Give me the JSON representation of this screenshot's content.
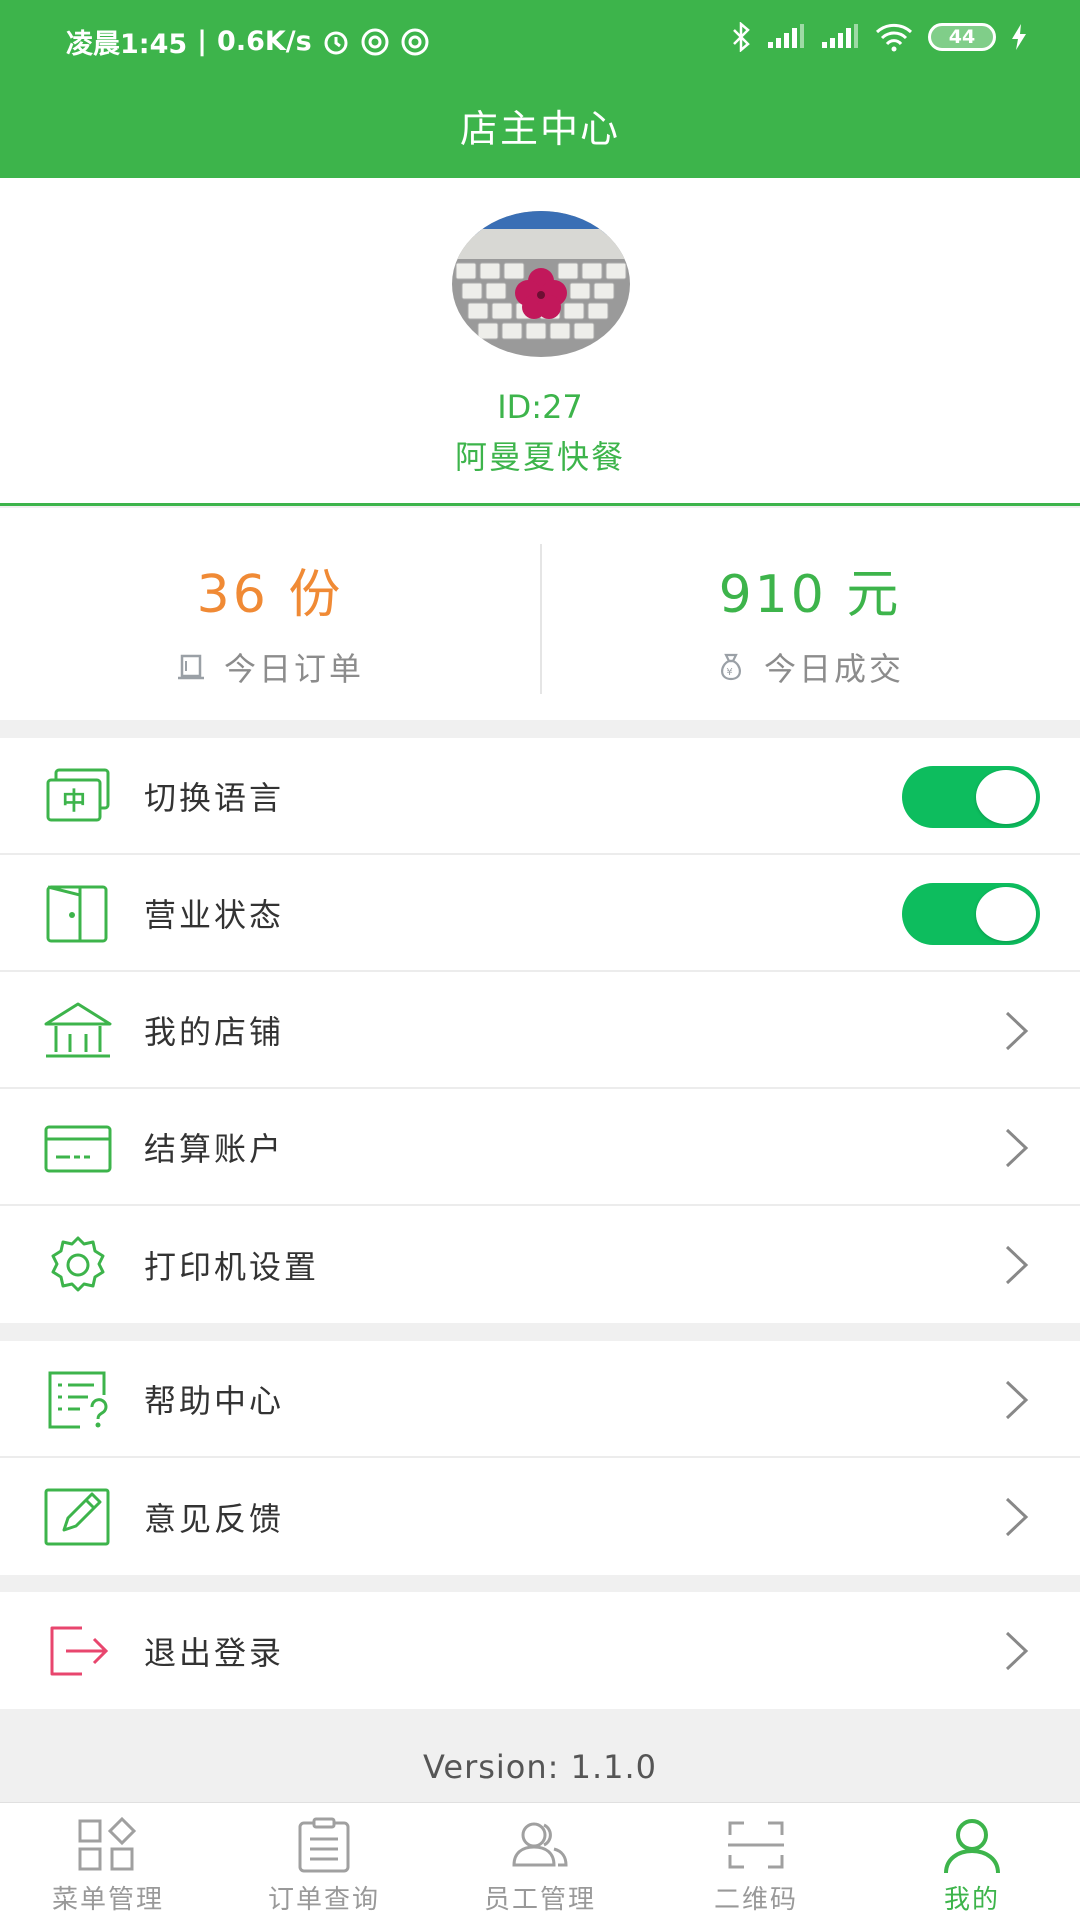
{
  "status_bar": {
    "time": "凌晨1:45",
    "speed": "0.6K/s",
    "battery": "44"
  },
  "header": {
    "title": "店主中心"
  },
  "profile": {
    "id": "ID:27",
    "shop_name": "阿曼夏快餐"
  },
  "stats": {
    "orders_value": "36 份",
    "orders_label": "今日订单",
    "sales_value": "910 元",
    "sales_label": "今日成交"
  },
  "menu": {
    "language": "切换语言",
    "business_status": "营业状态",
    "my_store": "我的店铺",
    "settlement_account": "结算账户",
    "printer_settings": "打印机设置",
    "help_center": "帮助中心",
    "feedback": "意见反馈",
    "logout": "退出登录"
  },
  "toggles": {
    "language_on": true,
    "business_on": true
  },
  "version": "Version: 1.1.0",
  "bottom_nav": [
    {
      "label": "菜单管理",
      "icon": "grid-icon"
    },
    {
      "label": "订单查询",
      "icon": "clipboard-icon"
    },
    {
      "label": "员工管理",
      "icon": "staff-icon"
    },
    {
      "label": "二维码",
      "icon": "qr-scan-icon"
    },
    {
      "label": "我的",
      "icon": "user-icon"
    }
  ],
  "colors": {
    "primary": "#3db44b",
    "orange": "#f08a35",
    "toggle": "#0dbd5e",
    "logout": "#e8466e"
  }
}
